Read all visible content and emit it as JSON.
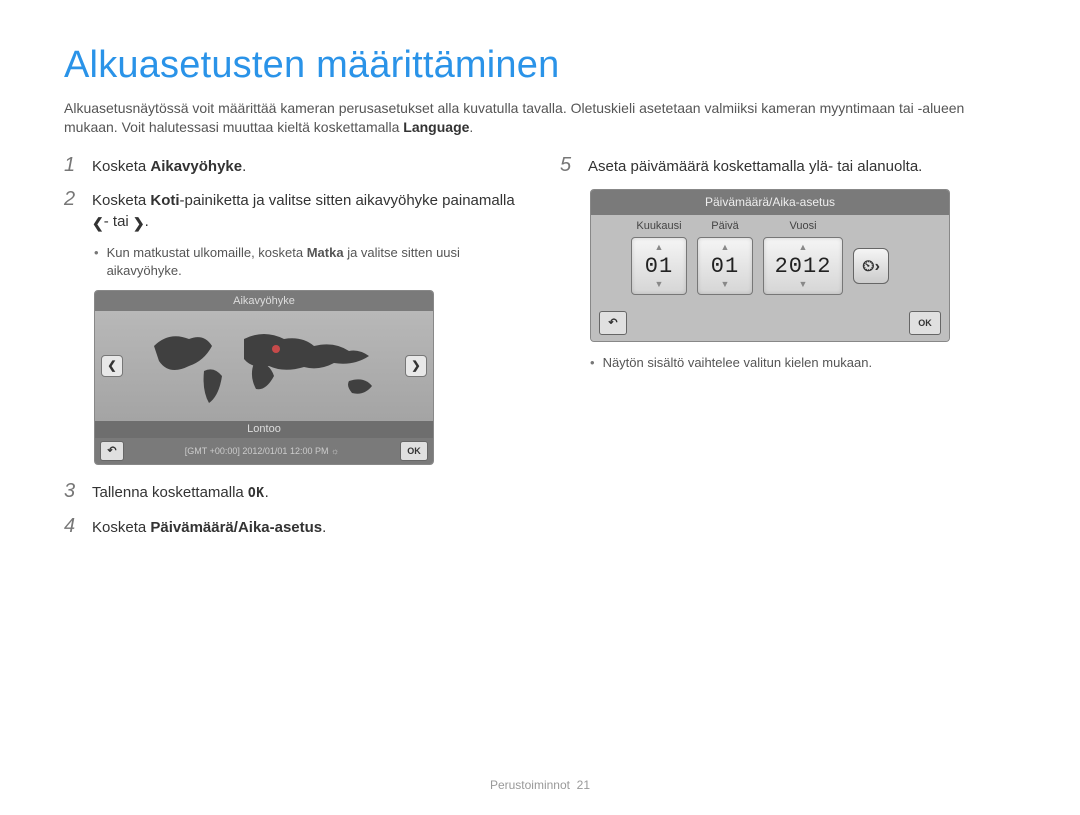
{
  "title": "Alkuasetusten määrittäminen",
  "intro": {
    "line1_prefix": "Alkuasetusnäytössä voit määrittää kameran perusasetukset alla kuvatulla tavalla. Oletuskieli asetetaan valmiiksi kameran myyntimaan tai -alueen mukaan. Voit halutessasi muuttaa kieltä koskettamalla ",
    "bold": "Language",
    "line1_suffix": "."
  },
  "steps": {
    "s1": {
      "num": "1",
      "pre": "Kosketa ",
      "bold": "Aikavyöhyke",
      "post": "."
    },
    "s2": {
      "num": "2",
      "pre": "Kosketa ",
      "bold": "Koti",
      "mid": "-painiketta ja valitse sitten aikavyöhyke painamalla ",
      "post": "."
    },
    "s2bullet": {
      "pre": "Kun matkustat ulkomaille, kosketa ",
      "bold": "Matka",
      "post": " ja valitse sitten uusi aikavyöhyke."
    },
    "s3": {
      "num": "3",
      "pre": "Tallenna koskettamalla ",
      "post": "."
    },
    "s4": {
      "num": "4",
      "pre": "Kosketa ",
      "bold": "Päivämäärä/Aika-asetus",
      "post": "."
    },
    "s5": {
      "num": "5",
      "text": "Aseta päivämäärä koskettamalla ylä- tai alanuolta."
    },
    "s5bullet": "Näytön sisältö vaihtelee valitun kielen mukaan."
  },
  "icons": {
    "left": "❮",
    "right": "❯",
    "or": "- tai ",
    "ok": "OK",
    "back": "↶",
    "clock": "⏲›"
  },
  "tz_screen": {
    "title": "Aikavyöhyke",
    "city": "Lontoo",
    "info": "[GMT +00:00] 2012/01/01 12:00 PM ☼"
  },
  "dt_screen": {
    "title": "Päivämäärä/Aika-asetus",
    "labels": {
      "month": "Kuukausi",
      "day": "Päivä",
      "year": "Vuosi"
    },
    "values": {
      "month": "01",
      "day": "01",
      "year": "2012"
    }
  },
  "footer": {
    "section": "Perustoiminnot",
    "page": "21"
  }
}
